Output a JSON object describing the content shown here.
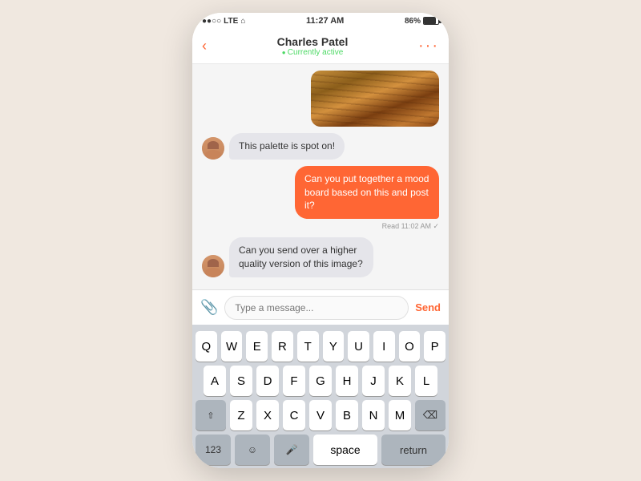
{
  "status_bar": {
    "signal": "●●○○",
    "network": "LTE",
    "wifi": "▲",
    "time": "11:27 AM",
    "battery_pct": "86%"
  },
  "nav": {
    "back_icon": "‹",
    "contact_name": "Charles Patel",
    "contact_status": "Currently active",
    "more_icon": "···"
  },
  "messages": [
    {
      "id": "msg1",
      "type": "received",
      "text": "This palette is spot on!",
      "avatar": true
    },
    {
      "id": "msg2",
      "type": "sent",
      "text": "Can you put together a mood board based on this and post it?"
    },
    {
      "id": "msg3",
      "type": "read_receipt",
      "text": "Read 11:02 AM ✓"
    },
    {
      "id": "msg4",
      "type": "received",
      "text": "Can you send over a higher quality version of this image?",
      "avatar": true
    }
  ],
  "input_bar": {
    "placeholder": "Type a message...",
    "send_label": "Send"
  },
  "keyboard": {
    "rows": [
      [
        "Q",
        "W",
        "E",
        "R",
        "T",
        "Y",
        "U",
        "I",
        "O",
        "P"
      ],
      [
        "A",
        "S",
        "D",
        "F",
        "G",
        "H",
        "J",
        "K",
        "L"
      ],
      [
        "Z",
        "X",
        "C",
        "V",
        "B",
        "N",
        "M"
      ]
    ],
    "bottom": {
      "num_label": "123",
      "emoji_icon": "☺",
      "mic_icon": "🎤",
      "space_label": "space",
      "return_label": "return"
    }
  }
}
